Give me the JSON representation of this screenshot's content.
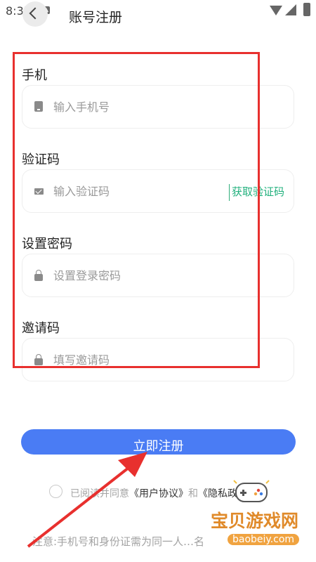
{
  "status_bar": {
    "time": "8:37"
  },
  "header": {
    "title": "账号注册"
  },
  "form": {
    "phone": {
      "label": "手机",
      "placeholder": "输入手机号"
    },
    "code": {
      "label": "验证码",
      "placeholder": "输入验证码",
      "get_code": "获取验证码"
    },
    "password": {
      "label": "设置密码",
      "placeholder": "设置登录密码"
    },
    "invite": {
      "label": "邀请码",
      "placeholder": "填写邀请码"
    }
  },
  "submit_label": "立即注册",
  "agreement": {
    "prefix": "已阅读并同意",
    "user_agreement": "《用户协议》",
    "conjunction": "和",
    "privacy_policy": "《隐私政策》"
  },
  "note": "注意:手机号和身份证需为同一人…名",
  "watermark": {
    "title": "宝贝游戏网",
    "domain": "baobeiy.com"
  },
  "colors": {
    "accent": "#4a7cf4",
    "link_green": "#22b07d",
    "annotation_red": "#e8302e"
  }
}
